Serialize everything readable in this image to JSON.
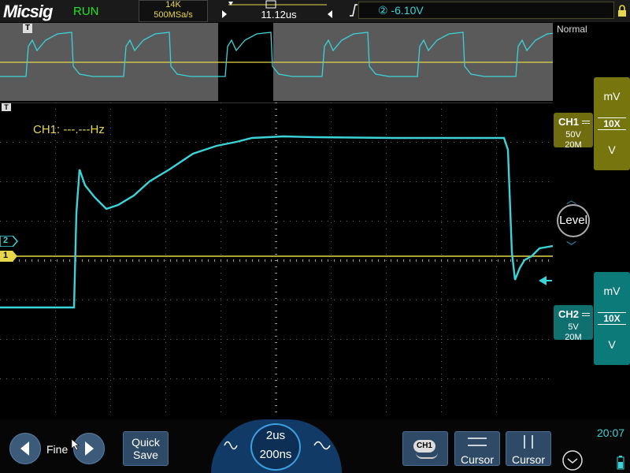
{
  "topbar": {
    "brand": "Micsig",
    "status": "RUN",
    "memory_depth": "14K",
    "sample_rate": "500MSa/s",
    "trigger_position_time": "11.12us",
    "trigger_level": "② -6.10V"
  },
  "overview": {
    "trigger_marker": "T"
  },
  "main": {
    "frequency_readout": "CH1: ---.---Hz",
    "ch1_marker": "1",
    "ch2_marker": "2",
    "trigger_marker": "T"
  },
  "right_panel": {
    "trigger_mode": "Normal",
    "ch1": {
      "name": "CH1",
      "scale": "50V",
      "bandwidth": "20M",
      "unit_up": "mV",
      "probe": "10X",
      "unit_down": "V"
    },
    "ch2": {
      "name": "CH2",
      "scale": "5V",
      "bandwidth": "20M",
      "unit_up": "mV",
      "probe": "10X",
      "unit_down": "V"
    },
    "level_label": "Level"
  },
  "bottombar": {
    "fine_label": "Fine",
    "quick_save_line1": "Quick",
    "quick_save_line2": "Save",
    "timebase_main": "2us",
    "timebase_zoom": "200ns",
    "channel_menu_label": "CH1",
    "cursor_h_label": "Cursor",
    "cursor_v_label": "Cursor",
    "clock": "20:07"
  },
  "colors": {
    "ch1": "#e6d84a",
    "ch2": "#3bd3d8",
    "run": "#22e322"
  },
  "icons": {
    "left_arrow": "left-arrow-icon",
    "right_arrow": "right-arrow-icon",
    "wave": "sine-wave-icon",
    "lock": "lock-icon",
    "battery": "battery-icon",
    "collapse": "chevron-down-icon"
  }
}
